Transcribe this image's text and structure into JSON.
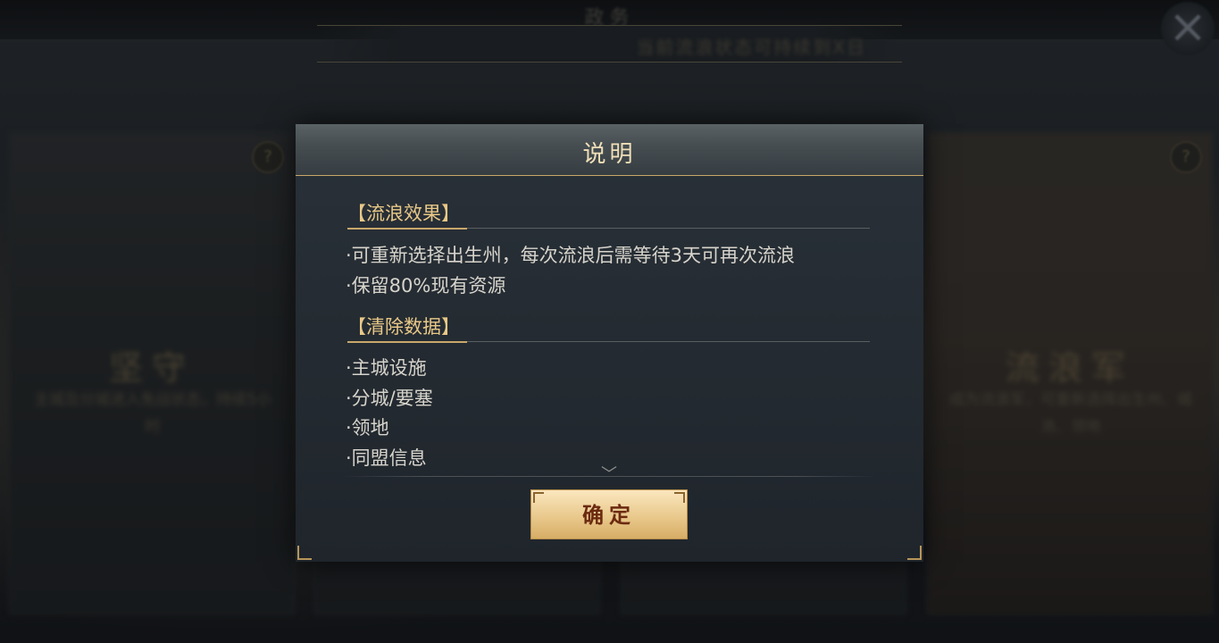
{
  "background": {
    "top_title": "政务",
    "sub_banner": "当前流浪状态可持续到X日",
    "cards": [
      {
        "title": "坚守",
        "desc": "主城及分城进入免战状态，持续5小时"
      },
      {
        "title": "",
        "desc": ""
      },
      {
        "title": "",
        "desc": ""
      },
      {
        "title": "流浪军",
        "desc": "成为流浪军，可重新选择出生州、城池、领地"
      }
    ],
    "help_icon": "?",
    "close_icon": "×"
  },
  "modal": {
    "title": "说明",
    "sections": [
      {
        "heading": "【流浪效果】",
        "lines": [
          "·可重新选择出生州，每次流浪后需等待3天可再次流浪",
          "·保留80%现有资源"
        ]
      },
      {
        "heading": "【清除数据】",
        "lines": [
          "·主城设施",
          "·分城/要塞",
          "·领地",
          "·同盟信息"
        ]
      }
    ],
    "scroll_indicator": "﹀",
    "confirm_label": "确定"
  },
  "colors": {
    "accent_gold": "#e8c887",
    "title_text": "#f0dfb8",
    "body_text": "#d7d4cc",
    "button_text": "#6b2a10"
  }
}
